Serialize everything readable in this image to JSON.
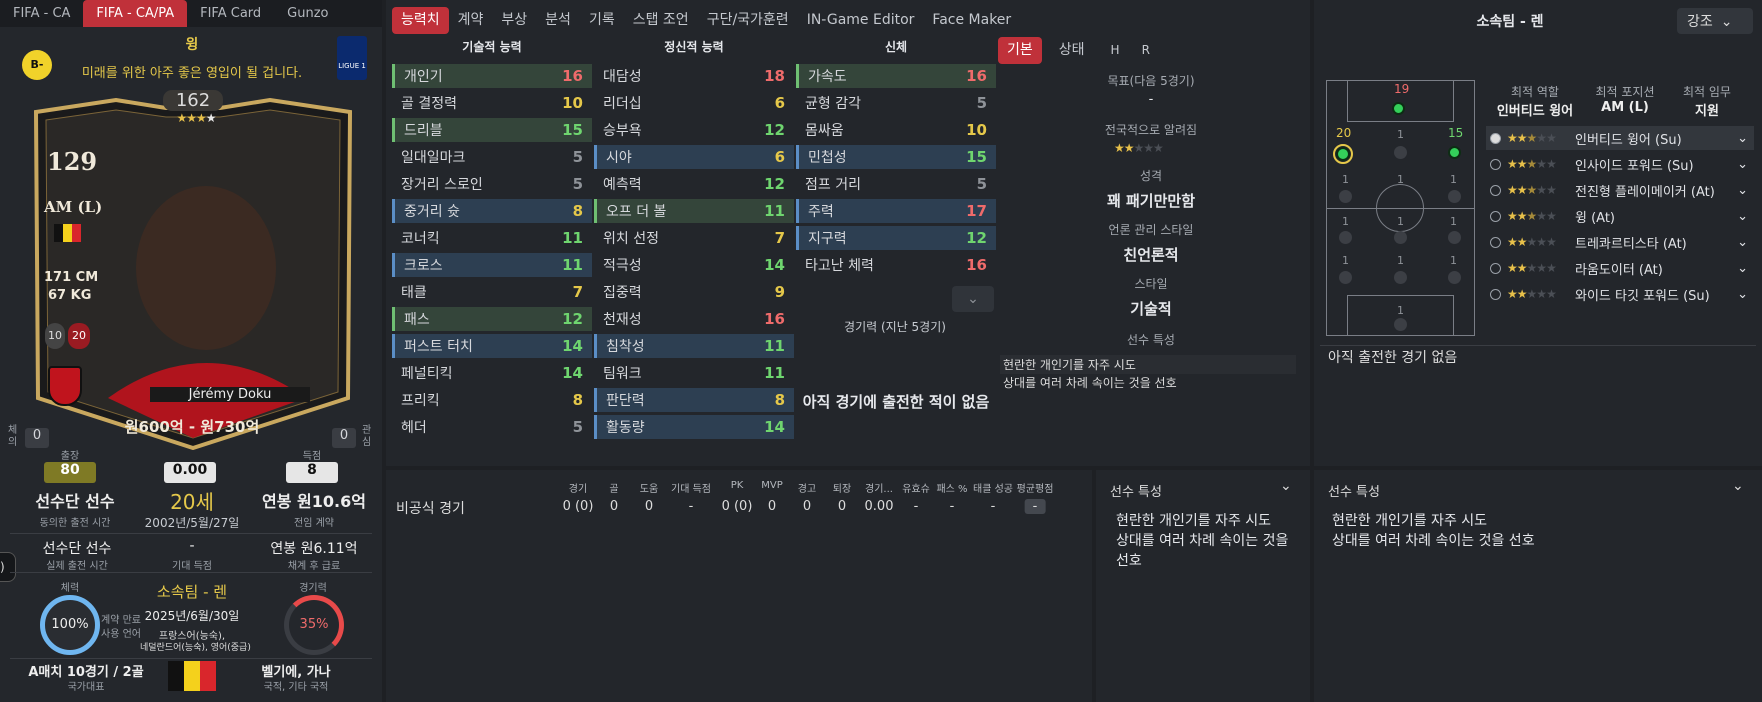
{
  "top_tabs": [
    "FIFA - CA",
    "FIFA - CA/PA",
    "FIFA Card",
    "Gunzo"
  ],
  "card": {
    "grade": "B-",
    "position_title": "윙",
    "description": "미래를 위한 아주 좋은 영입이 될 겁니다.",
    "rating_total": "162",
    "stars_on": 3,
    "stars_total": 4,
    "overall": "129",
    "position": "AM (L)",
    "height": "171 CM",
    "weight": "67 KG",
    "badge1": "10",
    "badge2": "20",
    "player_name": "Jérémy Doku",
    "value_range": "원600억 - 원730억",
    "league": "LIGUE 1",
    "left_label": "체의",
    "left_value": "0",
    "right_label": "관심",
    "right_value": "0"
  },
  "stats": {
    "appearances_label": "출장",
    "appearances": "80",
    "rating": "0.00",
    "goals_label": "득점",
    "goals": "8",
    "status": "선수단 선수",
    "status_sub": "동의한 출전 시간",
    "age": "20세",
    "dob": "2002년/5월/27일",
    "wage": "연봉 원10.6억",
    "wage_sub": "전임 계약",
    "actual_status": "선수단 선수",
    "actual_sub": "실제 출전 시간",
    "expected_goals": "-",
    "expected_sub": "기대 득점",
    "actual_wage": "연봉 원6.11억",
    "actual_wage_sub": "채계 후 급료",
    "fitness_label": "체력",
    "fitness": "100%",
    "contract_end_label": "계약 만료",
    "language_label": "사용 언어",
    "club": "소속팀 - 렌",
    "contract_end": "2025년/6월/30일",
    "languages": "프랑스어(능숙),",
    "languages2": "네덜란드어(능숙), 영어(중급)",
    "sharpness_label": "경기력",
    "sharpness": "35%",
    "caps": "A매치 10경기 / 2골",
    "caps_sub": "국가대표",
    "nationality": "벨기에, 가나",
    "nationality_sub": "국적, 기타 국적"
  },
  "tabs": [
    "능력치",
    "계약",
    "부상",
    "분석",
    "기록",
    "스탭 조언",
    "구단/국가훈련",
    "IN-Game Editor",
    "Face Maker"
  ],
  "attr_headers": {
    "technical": "기술적 능력",
    "mental": "정신적 능력",
    "physical": "신체"
  },
  "technical": [
    [
      "개인기",
      "16"
    ],
    [
      "골 결정력",
      "10"
    ],
    [
      "드리블",
      "15"
    ],
    [
      "일대일마크",
      "5"
    ],
    [
      "장거리 스로인",
      "5"
    ],
    [
      "중거리 슛",
      "8"
    ],
    [
      "코너킥",
      "11"
    ],
    [
      "크로스",
      "11"
    ],
    [
      "태클",
      "7"
    ],
    [
      "패스",
      "12"
    ],
    [
      "퍼스트 터치",
      "14"
    ],
    [
      "페널티킥",
      "14"
    ],
    [
      "프리킥",
      "8"
    ],
    [
      "헤더",
      "5"
    ]
  ],
  "mental": [
    [
      "대담성",
      "18"
    ],
    [
      "리더십",
      "6"
    ],
    [
      "승부욕",
      "12"
    ],
    [
      "시야",
      "6"
    ],
    [
      "예측력",
      "12"
    ],
    [
      "오프 더 볼",
      "11"
    ],
    [
      "위치 선정",
      "7"
    ],
    [
      "적극성",
      "14"
    ],
    [
      "집중력",
      "9"
    ],
    [
      "천재성",
      "16"
    ],
    [
      "침착성",
      "11"
    ],
    [
      "팀워크",
      "11"
    ],
    [
      "판단력",
      "8"
    ],
    [
      "활동량",
      "14"
    ]
  ],
  "physical": [
    [
      "가속도",
      "16"
    ],
    [
      "균형 감각",
      "5"
    ],
    [
      "몸싸움",
      "10"
    ],
    [
      "민첩성",
      "15"
    ],
    [
      "점프 거리",
      "5"
    ],
    [
      "주력",
      "17"
    ],
    [
      "지구력",
      "12"
    ],
    [
      "타고난 체력",
      "16"
    ]
  ],
  "form_label": "경기력 (지난 5경기)",
  "no_games": "아직 경기에 출전한 적이 없음",
  "sub_tabs": [
    "기본",
    "상태",
    "H",
    "R"
  ],
  "info": {
    "goal_label": "목표(다음 5경기)",
    "goal_val": "-",
    "known_label": "전국적으로 알려짐",
    "known_stars": 2,
    "personality_label": "성격",
    "personality": "꽤 패기만만함",
    "media_label": "언론 관리 스타일",
    "media": "친언론적",
    "style_label": "스타일",
    "style": "기술적",
    "traits_label": "선수 특성",
    "traits": [
      "현란한 개인기를 자주 시도",
      "상대를 여러 차례 속이는 것을 선호"
    ]
  },
  "right_panel": {
    "title": "소속팀 - 렌",
    "dropdown": "강조",
    "role_h": "최적 역할",
    "role_v": "인버티드 윙어",
    "pos_h": "최적 포지션",
    "pos_v": "AM (L)",
    "duty_h": "최적 임무",
    "duty_v": "지원",
    "no_games": "아직 출전한 경기 없음",
    "roles": [
      [
        "인버티드 윙어 (Su)",
        2.5
      ],
      [
        "인사이드 포워드 (Su)",
        2.5
      ],
      [
        "전진형 플레이메이커 (At)",
        2.5
      ],
      [
        "윙 (At)",
        2.5
      ],
      [
        "트레콰르티스타 (At)",
        2
      ],
      [
        "라움도이터 (At)",
        2
      ],
      [
        "와이드 타깃 포워드 (Su)",
        2
      ]
    ],
    "pitch_nums": {
      "top": "19",
      "left": "20",
      "right": "15"
    }
  },
  "games": {
    "row_label": "비공식 경기",
    "headers": [
      "경기",
      "골",
      "도움",
      "기대 득점",
      "PK",
      "MVP",
      "경고",
      "퇴장",
      "경기...",
      "유효슈",
      "패스 %",
      "태클 성공",
      "평균평점"
    ],
    "values": [
      "0 (0)",
      "0",
      "0",
      "-",
      "0 (0)",
      "0",
      "0",
      "0",
      "0.00",
      "-",
      "-",
      "-",
      "-"
    ]
  },
  "traits_panel": {
    "title": "선수 특성",
    "lines": [
      "현란한 개인기를 자주 시도",
      "상대를 여러 차례 속이는 것을",
      "선호"
    ]
  },
  "traits_panel2": {
    "title": "선수 특성",
    "lines": [
      "현란한 개인기를 자주 시도",
      "상대를 여러 차례 속이는 것을 선호"
    ]
  },
  "colors": {
    "accent": "#c0313a",
    "green": "#6fd56f",
    "yellow": "#e5c84a",
    "red": "#ef6b6b"
  }
}
